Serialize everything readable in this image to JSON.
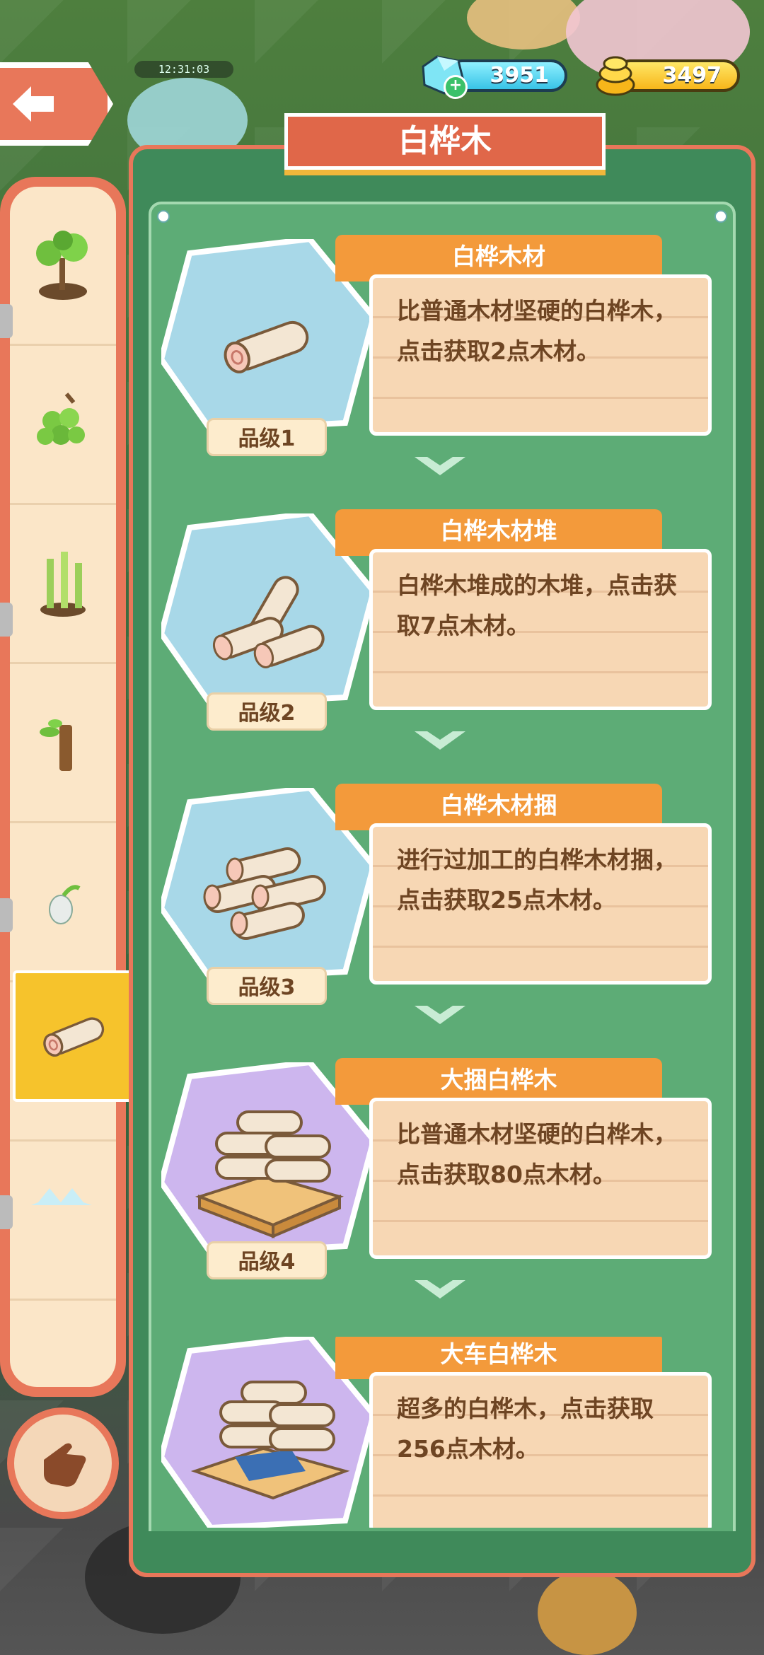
{
  "hud": {
    "clock": "12:31:03",
    "gems": "3951",
    "gold": "3497"
  },
  "title": "白桦木",
  "sidebar": {
    "items": [
      {
        "icon": "bonsai-tree-icon"
      },
      {
        "icon": "grapes-icon"
      },
      {
        "icon": "bamboo-icon"
      },
      {
        "icon": "sapling-stump-icon"
      },
      {
        "icon": "seed-bulb-icon"
      },
      {
        "icon": "birch-log-icon",
        "active": true
      },
      {
        "icon": "pink-orb-icon"
      },
      {
        "icon": "crystal-icon"
      }
    ]
  },
  "entries": [
    {
      "name": "白桦木材",
      "grade": "品级1",
      "desc": "比普通木材坚硬的白桦木，点击获取2点木材。",
      "bg": "blue",
      "icon": "single-log-icon"
    },
    {
      "name": "白桦木材堆",
      "grade": "品级2",
      "desc": "白桦木堆成的木堆，点击获取7点木材。",
      "bg": "blue",
      "icon": "log-pile-icon"
    },
    {
      "name": "白桦木材捆",
      "grade": "品级3",
      "desc": "进行过加工的白桦木材捆，点击获取25点木材。",
      "bg": "blue",
      "icon": "log-bundle-icon"
    },
    {
      "name": "大捆白桦木",
      "grade": "品级4",
      "desc": "比普通木材坚硬的白桦木，点击获取80点木材。",
      "bg": "purple",
      "icon": "log-pallet-icon"
    },
    {
      "name": "大车白桦木",
      "grade": "",
      "desc": "超多的白桦木，点击获取256点木材。",
      "bg": "purple",
      "icon": "log-cart-icon"
    }
  ],
  "colors": {
    "accent": "#e8775a",
    "panel_green": "#3f8a5a",
    "tab_orange": "#f39a3b",
    "card": "#f7d7b4",
    "hex_blue": "#a8d8e8",
    "hex_purple": "#cdb6ee",
    "text_brown": "#6e4523"
  }
}
